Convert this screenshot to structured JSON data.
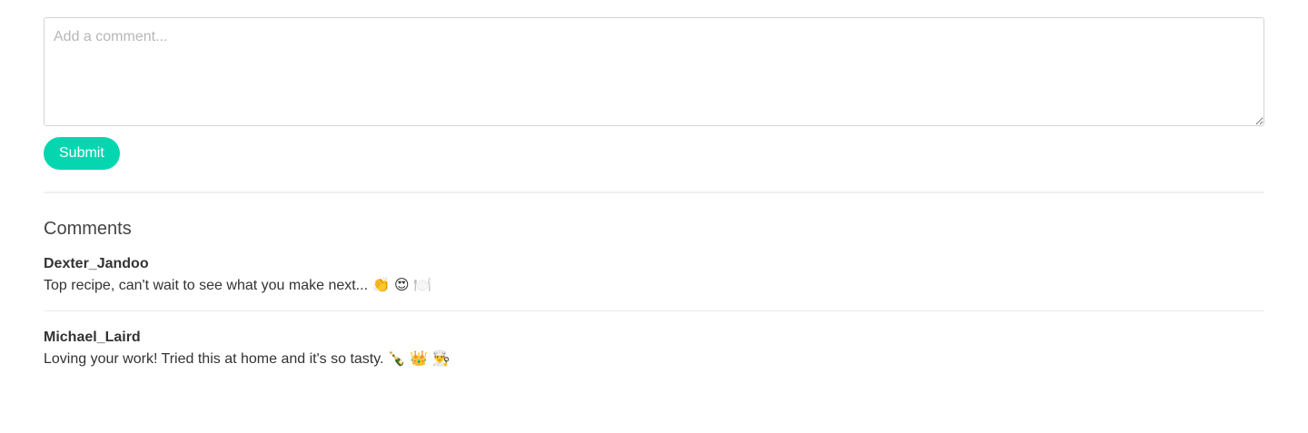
{
  "comment_form": {
    "placeholder": "Add a comment...",
    "value": "",
    "submit_label": "Submit"
  },
  "comments_section": {
    "title": "Comments",
    "comments": [
      {
        "author": "Dexter_Jandoo",
        "text": "Top recipe, can't wait to see what you make next... 👏 😍 🍽️"
      },
      {
        "author": "Michael_Laird",
        "text": "Loving your work! Tried this at home and it's so tasty. 🍾 👑 👨‍🍳"
      }
    ]
  },
  "colors": {
    "accent": "#06d6b0",
    "text": "#333333",
    "placeholder": "#b7b7b7",
    "border": "#d4d4d4"
  }
}
